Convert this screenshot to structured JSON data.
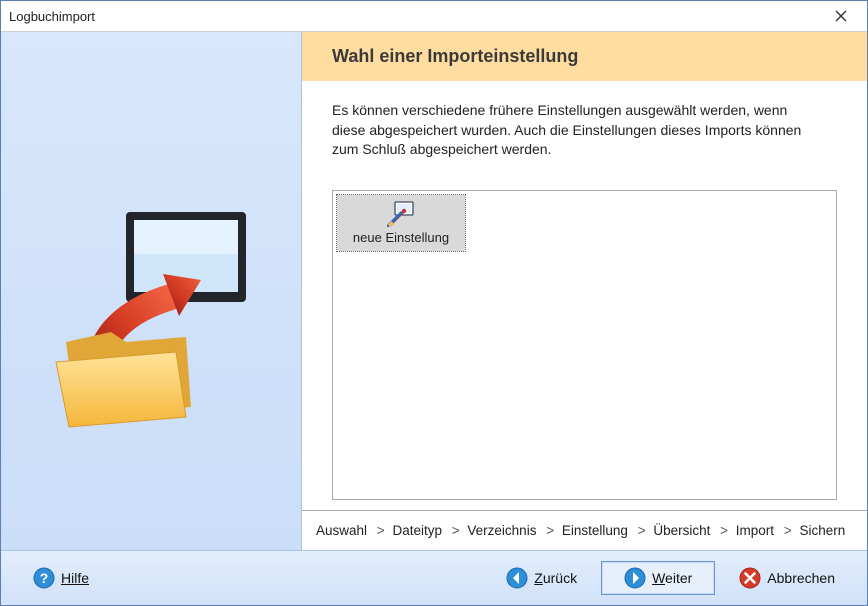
{
  "window": {
    "title": "Logbuchimport"
  },
  "page": {
    "heading": "Wahl einer Importeinstellung",
    "description": "Es können verschiedene frühere Einstellungen ausgewählt werden, wenn diese abgespeichert wurden. Auch die Einstellungen dieses Imports können zum Schluß abgespeichert werden."
  },
  "list": {
    "items": [
      {
        "label": "neue Einstellung"
      }
    ]
  },
  "breadcrumbs": {
    "items": [
      "Auswahl",
      "Dateityp",
      "Verzeichnis",
      "Einstellung",
      "Übersicht",
      "Import",
      "Sichern"
    ],
    "sep": ">"
  },
  "footer": {
    "help_mn": "H",
    "help_rest": "ilfe",
    "back_mn": "Z",
    "back_rest": "urück",
    "next_mn": "W",
    "next_rest": "eiter",
    "cancel_label": "Abbrechen"
  }
}
